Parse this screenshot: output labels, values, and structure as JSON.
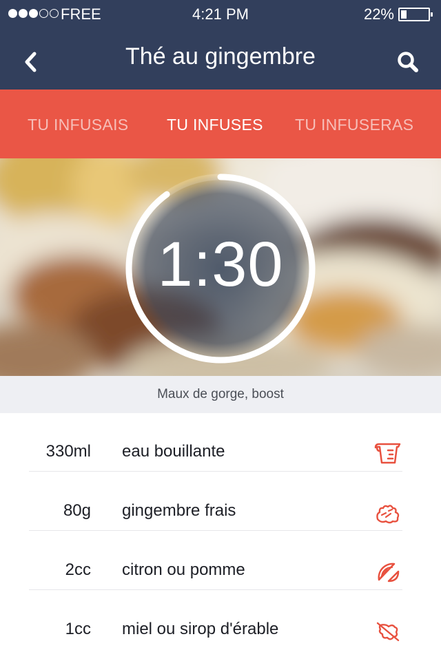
{
  "status_bar": {
    "carrier": "FREE",
    "signal_bars_filled": 3,
    "signal_bars_total": 5,
    "time": "4:21  PM",
    "battery_percent": "22%",
    "battery_level": 0.22
  },
  "nav": {
    "title": "Thé au gingembre",
    "back_icon": "chevron-left-icon",
    "search_icon": "search-icon"
  },
  "tabs": {
    "past": "TU INFUSAIS",
    "present": "TU INFUSES",
    "future": "TU INFUSERAS",
    "active": "present"
  },
  "timer": {
    "display": "1:30",
    "progress": 0.9
  },
  "subtitle": "Maux de gorge, boost",
  "ingredients": [
    {
      "qty": "330ml",
      "name": "eau bouillante",
      "icon": "measuring-cup-icon"
    },
    {
      "qty": "80g",
      "name": "gingembre frais",
      "icon": "ginger-root-icon"
    },
    {
      "qty": "2cc",
      "name": "citron ou pomme",
      "icon": "lemon-slice-icon"
    },
    {
      "qty": "1cc",
      "name": "miel ou sirop d'érable",
      "icon": "maple-leaf-icon"
    }
  ],
  "colors": {
    "navy": "#323f5c",
    "coral": "#ea5646",
    "icon_accent": "#e8513f",
    "band": "#eeeff3"
  }
}
